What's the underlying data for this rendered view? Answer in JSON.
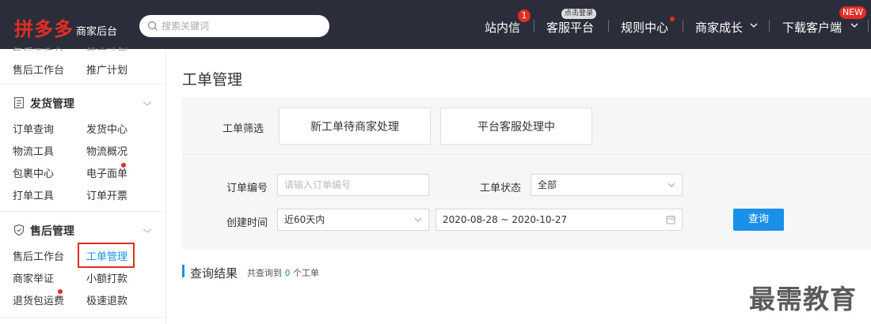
{
  "header": {
    "logo_text": "拼多多",
    "logo_subtitle": "商家后台",
    "search_placeholder": "搜索关键词",
    "nav": {
      "messages": "站内信",
      "messages_badge": "1",
      "service": "客服平台",
      "service_badge": "点击登录",
      "rules": "规则中心",
      "growth": "商家成长",
      "download": "下载客户端",
      "download_badge": "NEW"
    }
  },
  "sidebar": {
    "top_cut": [
      "售后工作台",
      "推广计划"
    ],
    "top_links": [
      "售后工作台",
      "推广计划"
    ],
    "shipping": {
      "title": "发货管理",
      "items": [
        "订单查询",
        "发货中心",
        "物流工具",
        "物流概况",
        "包裹中心",
        "电子面单",
        "打单工具",
        "订单开票"
      ]
    },
    "aftersale": {
      "title": "售后管理",
      "items": [
        "售后工作台",
        "工单管理",
        "商家举证",
        "小额打款",
        "退货包运费",
        "极速退款"
      ]
    }
  },
  "main": {
    "title": "工单管理",
    "filter": {
      "label": "工单筛选",
      "chips": [
        "新工单待商家处理",
        "平台客服处理中"
      ]
    },
    "order_no": {
      "label": "订单编号",
      "placeholder": "请输入订单编号"
    },
    "status": {
      "label": "工单状态",
      "value": "全部"
    },
    "created": {
      "label": "创建时间",
      "range_value": "近60天内",
      "date_range": "2020-08-28 ~ 2020-10-27"
    },
    "query_button": "查询",
    "results": {
      "title": "查询结果",
      "prefix": "共查询到",
      "count": "0",
      "suffix": "个工单"
    }
  },
  "watermark": "最需教育",
  "colors": {
    "brand": "#e02e24",
    "topbar": "#2b2d3a",
    "primary": "#1a90e8"
  }
}
